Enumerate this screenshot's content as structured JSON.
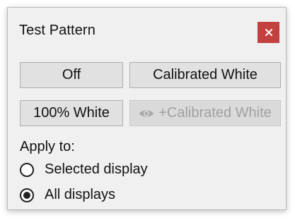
{
  "dialog": {
    "title": "Test Pattern",
    "close_icon": "close-icon"
  },
  "buttons": {
    "off_label": "Off",
    "calibrated_white_label": "Calibrated White",
    "white100_label": "100% White",
    "plus_calibrated_white_label": "+Calibrated White",
    "plus_calibrated_white_icon": "eye-icon",
    "plus_calibrated_white_enabled": false
  },
  "apply_to": {
    "label": "Apply to:",
    "options": [
      {
        "label": "Selected display",
        "selected": false
      },
      {
        "label": "All displays",
        "selected": true
      }
    ]
  },
  "colors": {
    "close_button": "#c2413f",
    "dialog_background": "#f0f0f0",
    "button_background": "#e1e1e1",
    "disabled_text": "#a0a0a0"
  }
}
